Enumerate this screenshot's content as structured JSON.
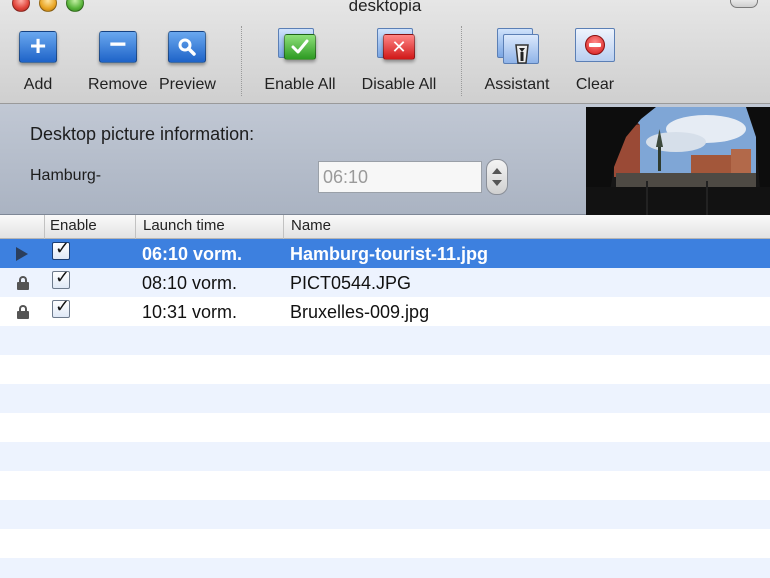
{
  "window": {
    "title": "desktopia"
  },
  "toolbar": {
    "add_label": "Add",
    "remove_label": "Remove",
    "preview_label": "Preview",
    "enable_all_label": "Enable All",
    "disable_all_label": "Disable All",
    "assistant_label": "Assistant",
    "clear_label": "Clear"
  },
  "info": {
    "heading": "Desktop picture information:",
    "picture_name": "Hamburg-",
    "time_value": "06:10"
  },
  "table": {
    "headers": {
      "enable": "Enable",
      "launch_time": "Launch time",
      "name": "Name"
    },
    "rows": [
      {
        "enabled": true,
        "launch_time": "06:10 vorm.",
        "name": "Hamburg-tourist-11.jpg",
        "selected": true,
        "marker": "disclosure"
      },
      {
        "enabled": true,
        "launch_time": "08:10 vorm.",
        "name": "PICT0544.JPG",
        "selected": false,
        "marker": "lock"
      },
      {
        "enabled": true,
        "launch_time": "10:31 vorm.",
        "name": "Bruxelles-009.jpg",
        "selected": false,
        "marker": "lock"
      }
    ]
  },
  "icons": {
    "add": "plus-icon",
    "remove": "minus-icon",
    "preview": "magnifier-icon",
    "enable_all": "checkmark-icon",
    "disable_all": "x-icon",
    "assistant": "assistant-icon",
    "clear": "no-entry-icon"
  },
  "colors": {
    "selection": "#3d80df",
    "row_stripe": "#edf3fe",
    "info_panel": "#b3bbc8"
  }
}
